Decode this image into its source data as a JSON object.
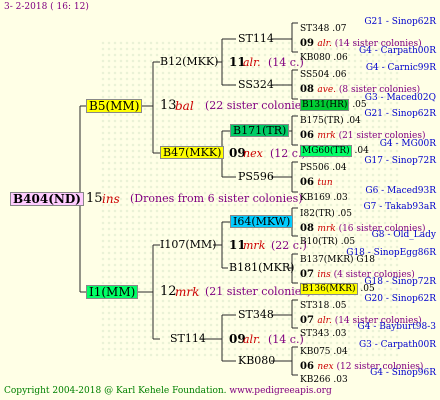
{
  "header": {
    "date": "3-  2-2018 ( 16: 12)"
  },
  "root": {
    "name": "B404(ND)",
    "number": "15",
    "race": "ins",
    "note": "(Drones from 6 sister colonies)"
  },
  "gen1": {
    "sire": {
      "name": "B5(MM)",
      "number": "13",
      "race": "bal",
      "note": "(22 sister colonies)"
    },
    "dam": {
      "name": "I1(MM)",
      "number": "12",
      "race": "mrk",
      "note": "(21 sister colonies)"
    }
  },
  "gen2": [
    {
      "name": "B12(MKK)",
      "number": "11",
      "race": "alr.",
      "note": "(14 c.)"
    },
    {
      "name": "B47(MKK)",
      "number": "09",
      "race": "nex",
      "note": "(12 c.)"
    },
    {
      "name": "I107(MM)",
      "number": "11",
      "race": "mrk",
      "note": "(22 c.)"
    },
    {
      "name": "ST114",
      "number": "09",
      "race": "alr.",
      "note": "(14 c.)"
    }
  ],
  "gen3": [
    {
      "name": "ST114"
    },
    {
      "name": "SS324"
    },
    {
      "name": "B171(TR)"
    },
    {
      "name": "PS596"
    },
    {
      "name": "I64(MKW)"
    },
    {
      "name": "B181(MKR)"
    },
    {
      "name": "ST348"
    },
    {
      "name": "KB080"
    }
  ],
  "gen4": [
    {
      "kind": "entry",
      "id": "ST348",
      "year": ".07",
      "ref": "G21 - Sinop62R"
    },
    {
      "kind": "meta",
      "number": "09",
      "race": "alr.",
      "note": "(14 sister colonies)"
    },
    {
      "kind": "entry",
      "id": "KB080",
      "year": ".06",
      "ref": "G4 - Carpath00R"
    },
    {
      "kind": "entry",
      "id": "SS504",
      "year": ".06",
      "ref": "G4 - Carnic99R"
    },
    {
      "kind": "meta",
      "number": "08",
      "race": "ave.",
      "note": "(8 sister colonies)"
    },
    {
      "kind": "entry",
      "id": "B131(HR)",
      "year": ".05",
      "ref": "G3 - Maced02Q",
      "hl": "#00cc33"
    },
    {
      "kind": "entry",
      "id": "B175(TR)",
      "year": ".04",
      "ref": "G21 - Sinop62R"
    },
    {
      "kind": "meta",
      "number": "06",
      "race": "mrk",
      "note": "(21 sister colonies)"
    },
    {
      "kind": "entry",
      "id": "MG60(TR)",
      "year": ".04",
      "ref": "G4 - MG00R",
      "hl": "#00ff66"
    },
    {
      "kind": "entry",
      "id": "PS506",
      "year": ".04",
      "ref": "G17 - Sinop72R"
    },
    {
      "kind": "meta",
      "number": "06",
      "race": "tun",
      "note": ""
    },
    {
      "kind": "entry",
      "id": "KB169",
      "year": ".03",
      "ref": "G6 - Maced93R"
    },
    {
      "kind": "entry",
      "id": "I82(TR)",
      "year": ".05",
      "ref": "G7 - Takab93aR"
    },
    {
      "kind": "meta",
      "number": "08",
      "race": "mrk",
      "note": "(16 sister colonies)"
    },
    {
      "kind": "entry",
      "id": "B10(TR)",
      "year": ".05",
      "ref": "G8 - Old_Lady"
    },
    {
      "kind": "entry",
      "id": "B137(MKR)",
      "year": "G18",
      "ref": "G18 - SinopEgg86R"
    },
    {
      "kind": "meta",
      "number": "07",
      "race": "ins",
      "note": "(4 sister colonies)"
    },
    {
      "kind": "entry",
      "id": "B136(MKR)",
      "year": ".05",
      "ref": "G18 - Sinop72R",
      "hl": "#ffff00"
    },
    {
      "kind": "entry",
      "id": "ST318",
      "year": ".05",
      "ref": "G20 - Sinop62R"
    },
    {
      "kind": "meta",
      "number": "07",
      "race": "alr.",
      "note": "(14 sister colonies)"
    },
    {
      "kind": "entry",
      "id": "ST343",
      "year": ".03",
      "ref": "G4 - Bayburt98-3"
    },
    {
      "kind": "entry",
      "id": "KB075",
      "year": ".04",
      "ref": "G3 - Carpath00R"
    },
    {
      "kind": "meta",
      "number": "06",
      "race": "nex",
      "note": "(12 sister colonies)"
    },
    {
      "kind": "entry",
      "id": "KB266",
      "year": ".03",
      "ref": "G4 - Sinop96R"
    }
  ],
  "footer": {
    "copyright": "Copyright 2004-2018 @ Karl Kehele Foundation.",
    "site": "www.pedigreeapis.org"
  }
}
